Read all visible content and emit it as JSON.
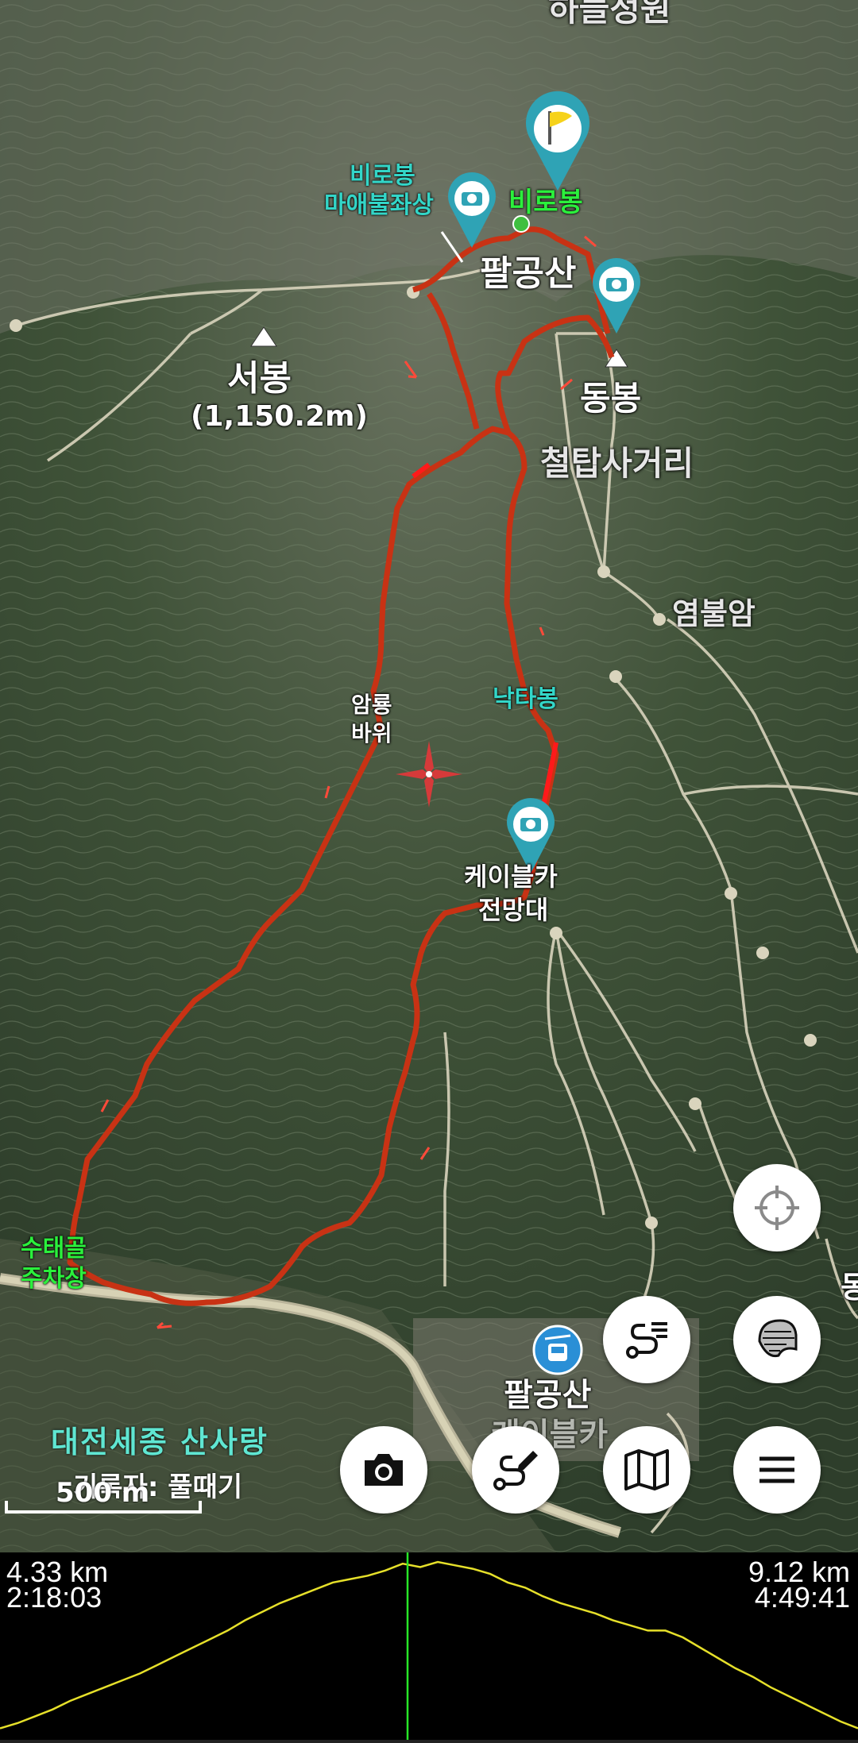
{
  "map": {
    "labels": {
      "hanul": "하늘정원",
      "birobong_buddha_l1": "비로봉",
      "birobong_buddha_l2": "마애불좌상",
      "birobong": "비로봉",
      "palgongsan": "팔공산",
      "seobong": "서봉",
      "seobong_elev": "(1,150.2m)",
      "dongbong": "동봉",
      "cheoltap": "철탑사거리",
      "yeombulam": "염불암",
      "amryong_l1": "암룡",
      "amryong_l2": "바위",
      "naktabong": "낙타봉",
      "cablecar_view_l1": "케이블카",
      "cablecar_view_l2": "전망대",
      "parking_l1": "수태골",
      "parking_l2": "주차장",
      "palgongsan_cable_l1": "팔공산",
      "palgongsan_cable_l2": "케이블카",
      "edge_char": "동"
    },
    "credit_title": "대전세종 산사랑",
    "credit_author": "기록자: 풀때기",
    "scale_label": "500 m",
    "colors": {
      "track": "#c83214",
      "track_bright": "#ff1a1a",
      "marker_teal": "#2fa3b5",
      "flag_yellow": "#f6d21a",
      "elevation_line": "#e6e02a",
      "cursor_line": "#27e627"
    },
    "markers": [
      "flag-marker",
      "camera-marker",
      "camera-marker",
      "camera-marker",
      "cablecar-marker"
    ]
  },
  "controls": {
    "gps_icon": "crosshair-icon",
    "layer_icon": "layers-icon",
    "route_icon": "route-list-icon",
    "camera_icon": "camera-icon",
    "edit_route_icon": "route-edit-icon",
    "map_icon": "map-icon",
    "menu_icon": "menu-icon"
  },
  "elevation": {
    "distance_current": "4.33 km",
    "time_current": "2:18:03",
    "distance_total": "9.12 km",
    "time_total": "4:49:41",
    "cursor_fraction": 0.475,
    "profile": [
      0.03,
      0.06,
      0.1,
      0.14,
      0.19,
      0.23,
      0.27,
      0.31,
      0.35,
      0.4,
      0.45,
      0.5,
      0.55,
      0.6,
      0.66,
      0.71,
      0.76,
      0.8,
      0.84,
      0.88,
      0.9,
      0.92,
      0.95,
      0.99,
      0.97,
      1.0,
      0.98,
      0.96,
      0.93,
      0.88,
      0.85,
      0.8,
      0.76,
      0.73,
      0.7,
      0.66,
      0.63,
      0.6,
      0.6,
      0.56,
      0.5,
      0.44,
      0.38,
      0.33,
      0.27,
      0.22,
      0.17,
      0.12,
      0.07,
      0.03
    ]
  }
}
